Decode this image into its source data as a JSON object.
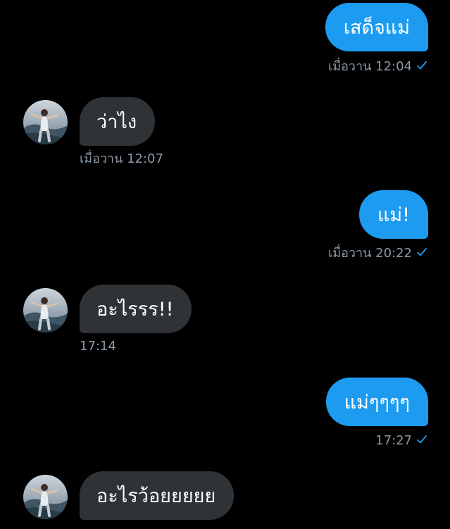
{
  "colors": {
    "background": "#000000",
    "outgoing_bubble": "#1d9bf0",
    "incoming_bubble": "#2f3336",
    "meta_text": "#8b98a5",
    "check": "#1d9bf0"
  },
  "messages": [
    {
      "direction": "outgoing",
      "text": "เสด็จแม่",
      "time": "เมื่อวาน 12:04",
      "status_icon": "check-icon"
    },
    {
      "direction": "incoming",
      "text": "ว่าไง",
      "time": "เมื่อวาน 12:07",
      "avatar_icon": "avatar"
    },
    {
      "direction": "outgoing",
      "text": "แม่!",
      "time": "เมื่อวาน 20:22",
      "status_icon": "check-icon"
    },
    {
      "direction": "incoming",
      "text": "อะไรรร!!",
      "time": "17:14",
      "avatar_icon": "avatar"
    },
    {
      "direction": "outgoing",
      "text": "แม่ๆๆๆๆ",
      "time": "17:27",
      "status_icon": "check-icon"
    },
    {
      "direction": "incoming",
      "text": "อะไรว้อยยยยย",
      "time": "",
      "avatar_icon": "avatar"
    }
  ]
}
